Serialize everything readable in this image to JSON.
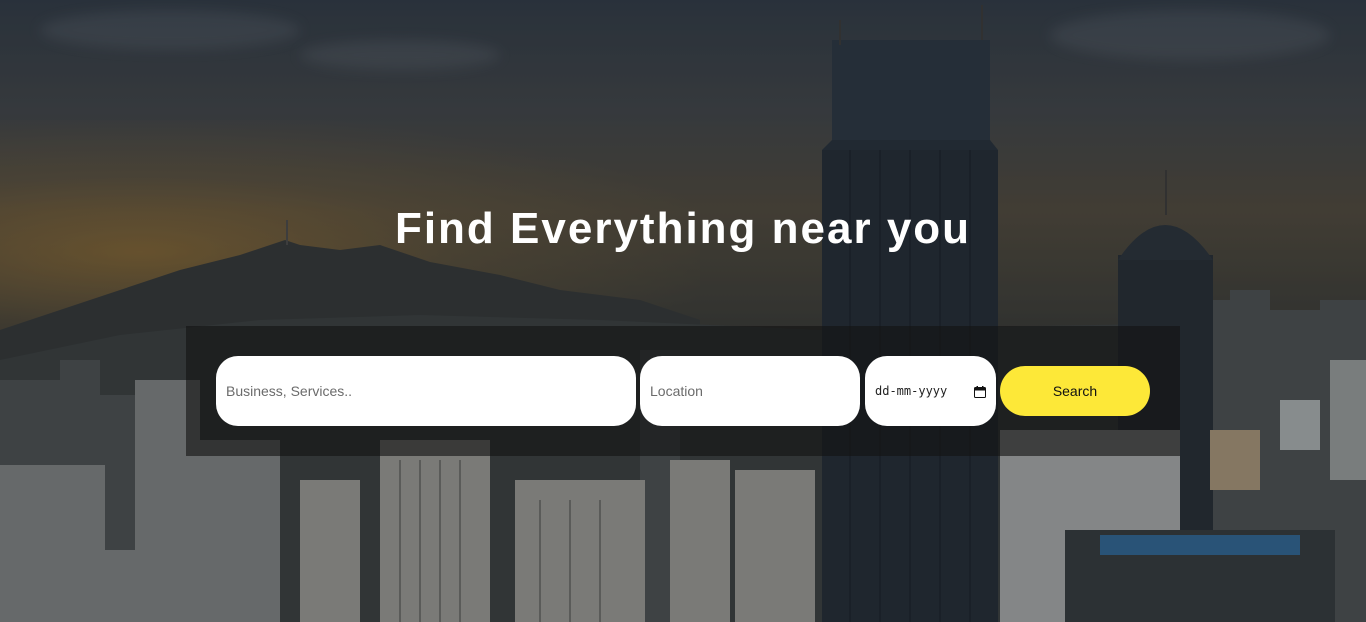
{
  "hero": {
    "title": "Find Everything near you"
  },
  "search": {
    "business_placeholder": "Business, Services..",
    "location_placeholder": "Location",
    "date_value": "dd-mm-yyyy",
    "button_label": "Search"
  },
  "colors": {
    "accent": "#fde838",
    "panel": "#141414",
    "title": "#ffffff"
  },
  "icons": {
    "date": "calendar-icon"
  }
}
